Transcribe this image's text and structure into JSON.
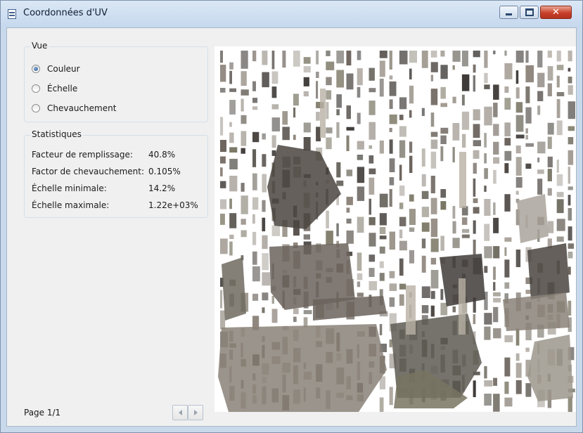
{
  "window": {
    "title": "Coordonnées d'UV",
    "controls": {
      "minimize_icon": "minimize-icon",
      "maximize_icon": "maximize-icon",
      "close_icon": "close-icon"
    }
  },
  "vue": {
    "title": "Vue",
    "options": [
      {
        "label": "Couleur",
        "checked": true
      },
      {
        "label": "Échelle",
        "checked": false
      },
      {
        "label": "Chevauchement",
        "checked": false
      }
    ]
  },
  "stats": {
    "title": "Statistiques",
    "rows": [
      {
        "label": "Facteur de remplissage:",
        "value": "40.8%"
      },
      {
        "label": "Factor de chevauchement:",
        "value": "0.105%"
      },
      {
        "label": "Échelle minimale:",
        "value": "14.2%"
      },
      {
        "label": "Échelle maximale:",
        "value": "1.22e+03%"
      }
    ]
  },
  "footer": {
    "page_label": "Page 1/1",
    "prev_icon": "chevron-left-icon",
    "next_icon": "chevron-right-icon"
  },
  "uv_view": {
    "content": "texture-atlas",
    "colors": [
      "#4a4440",
      "#6b635c",
      "#8a8178",
      "#5d5a52",
      "#787462",
      "#9c968c",
      "#3f3b38",
      "#6e6a5f",
      "#a9a39b"
    ]
  }
}
